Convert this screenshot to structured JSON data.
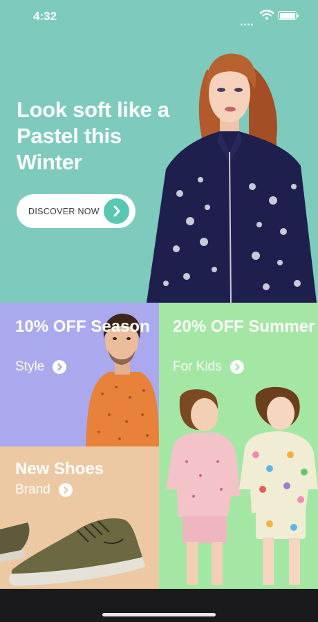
{
  "status_bar": {
    "time": "4:32"
  },
  "hero": {
    "title": "Look soft like a Pastel this Winter",
    "cta_label": "DISCOVER NOW"
  },
  "tiles": {
    "season": {
      "headline": "10% OFF Season",
      "subtitle": "Style"
    },
    "summer": {
      "headline": "20% OFF Summer",
      "subtitle": "For Kids"
    },
    "shoes": {
      "headline": "New Shoes",
      "subtitle": "Brand"
    }
  },
  "colors": {
    "hero_bg": "#7ecbbd",
    "accent": "#5ac7b3",
    "season_bg": "#aba9ee",
    "summer_bg": "#a4e7a4",
    "shoes_bg": "#ecc9a3"
  },
  "icons": [
    "wifi-icon",
    "battery-icon",
    "chevron-right-icon"
  ]
}
